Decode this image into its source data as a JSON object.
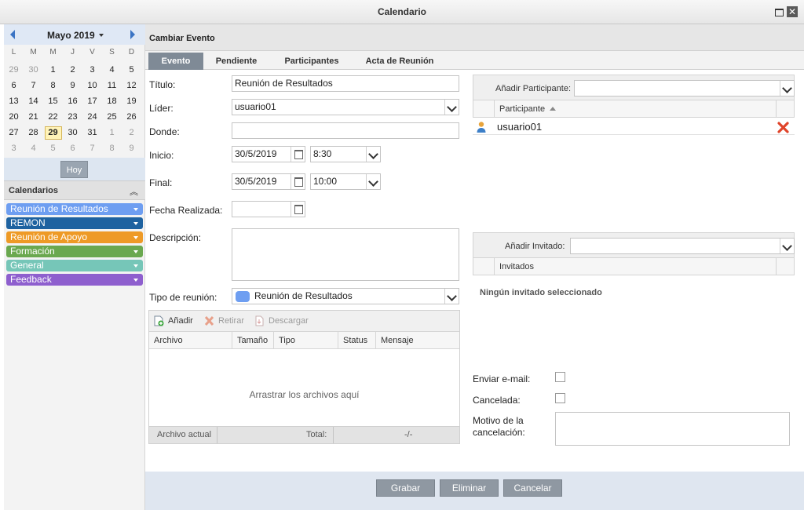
{
  "window": {
    "title": "Calendario"
  },
  "calendar": {
    "month_label": "Mayo 2019",
    "days_of_week": [
      "L",
      "M",
      "M",
      "J",
      "V",
      "S",
      "D"
    ],
    "weeks": [
      [
        "29",
        "30",
        "1",
        "2",
        "3",
        "4",
        "5"
      ],
      [
        "6",
        "7",
        "8",
        "9",
        "10",
        "11",
        "12"
      ],
      [
        "13",
        "14",
        "15",
        "16",
        "17",
        "18",
        "19"
      ],
      [
        "20",
        "21",
        "22",
        "23",
        "24",
        "25",
        "26"
      ],
      [
        "27",
        "28",
        "29",
        "30",
        "31",
        "1",
        "2"
      ],
      [
        "3",
        "4",
        "5",
        "6",
        "7",
        "8",
        "9"
      ]
    ],
    "today_button": "Hoy"
  },
  "calendars_section": {
    "title": "Calendarios",
    "items": [
      {
        "label": "Reunión de Resultados",
        "color": "#6e9ef1"
      },
      {
        "label": "REMON",
        "color": "#1e62a0"
      },
      {
        "label": "Reunión de Apoyo",
        "color": "#ee9a26"
      },
      {
        "label": "Formación",
        "color": "#6aa84f"
      },
      {
        "label": "General",
        "color": "#76c6b8"
      },
      {
        "label": "Feedback",
        "color": "#8e5fce"
      }
    ]
  },
  "main": {
    "header": "Cambiar Evento",
    "tabs": [
      "Evento",
      "Pendiente",
      "Participantes",
      "Acta de Reunión"
    ],
    "form": {
      "titulo_label": "Título:",
      "titulo_value": "Reunión de Resultados",
      "lider_label": "Líder:",
      "lider_value": "usuario01",
      "donde_label": "Donde:",
      "donde_value": "",
      "inicio_label": "Inicio:",
      "inicio_date": "30/5/2019",
      "inicio_time": "8:30",
      "final_label": "Final:",
      "final_date": "30/5/2019",
      "final_time": "10:00",
      "fecha_realizada_label": "Fecha Realizada:",
      "descripcion_label": "Descripción:",
      "tipo_label": "Tipo de reunión:",
      "tipo_value": "Reunión de Resultados",
      "tipo_color": "#6e9ef1"
    },
    "files": {
      "add": "Añadir",
      "remove": "Retirar",
      "download": "Descargar",
      "columns": [
        "Archivo",
        "Tamaño",
        "Tipo",
        "Status",
        "Mensaje"
      ],
      "drop_text": "Arrastrar los archivos aquí",
      "footer_current": "Archivo actual",
      "footer_total": "Total:",
      "footer_value": "-/-"
    },
    "participants": {
      "add_label": "Añadir Participante:",
      "column": "Participante",
      "rows": [
        "usuario01"
      ]
    },
    "guests": {
      "add_label": "Añadir Invitado:",
      "column": "Invitados",
      "empty_text": "Ningún invitado seleccionado"
    },
    "options": {
      "send_email": "Enviar e-mail:",
      "cancelled": "Cancelada:",
      "cancel_reason": "Motivo de la cancelación:"
    },
    "buttons": {
      "save": "Grabar",
      "delete": "Eliminar",
      "cancel": "Cancelar"
    }
  }
}
